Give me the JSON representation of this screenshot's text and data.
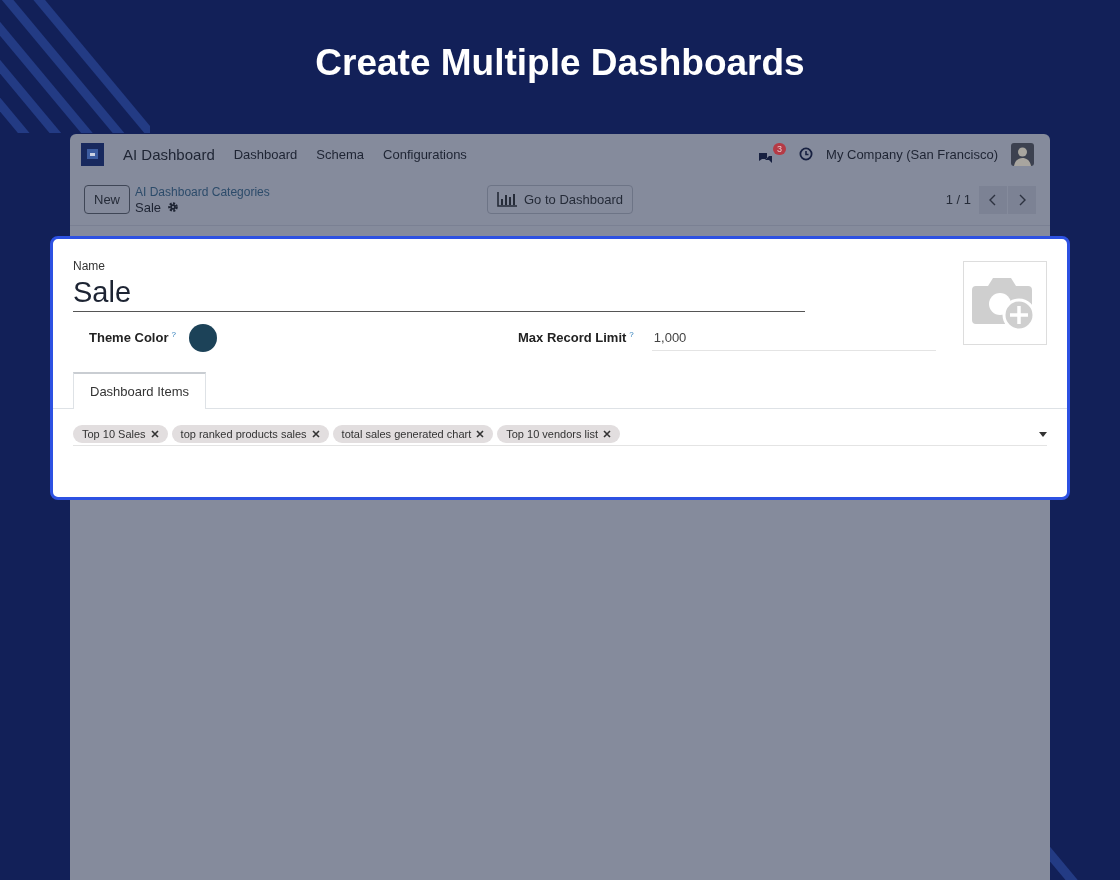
{
  "heading": "Create Multiple Dashboards",
  "navbar": {
    "app_name": "AI Dashboard",
    "menu": [
      "Dashboard",
      "Schema",
      "Configurations"
    ],
    "message_count": "3",
    "company": "My Company (San Francisco)"
  },
  "control_panel": {
    "new_button": "New",
    "breadcrumb_parent": "AI Dashboard Categories",
    "breadcrumb_current": "Sale",
    "action_button": "Go to Dashboard",
    "pager": "1 / 1"
  },
  "form": {
    "name_label": "Name",
    "name_value": "Sale",
    "fields": [
      {
        "kind": "color",
        "label": "Theme Color",
        "help": "?",
        "color": "#1c4258"
      },
      {
        "kind": "text",
        "label": "Max Record Limit",
        "help": "?",
        "value": "1,000"
      }
    ],
    "tabs": [
      {
        "label": "Dashboard Items",
        "selected": true
      }
    ],
    "tags": [
      "Top 10 Sales",
      "top ranked products sales",
      "total sales generated chart",
      "Top 10 vendors list"
    ]
  }
}
